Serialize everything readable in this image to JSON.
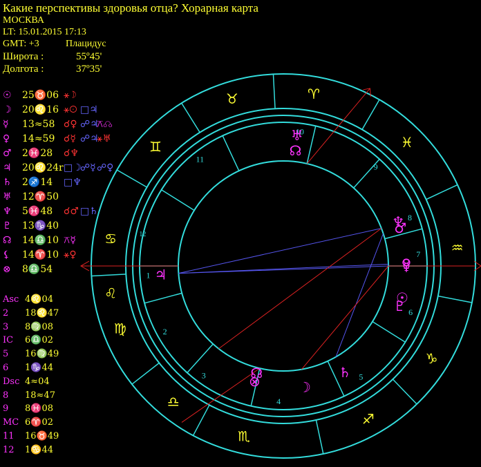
{
  "header": {
    "title": "Какие перспективы здоровья отца? Хорарная карта",
    "city": "МОСКВА",
    "lt": "LT: 15.01.2015  17:13",
    "gmt": "GMT: +3",
    "system": "Плацидус",
    "lat_label": "Широта :",
    "lat_value": "55º45'",
    "lon_label": "Долгота :",
    "lon_value": "37º35'"
  },
  "planets": [
    {
      "glyph": "☉",
      "color": "#ff33ff",
      "value": "25♉06",
      "aspects": [
        {
          "t": "⚹☽",
          "c": "#ff3333"
        }
      ]
    },
    {
      "glyph": "☽",
      "color": "#ff33ff",
      "value": "20♌16",
      "aspects": [
        {
          "t": "⚹☉",
          "c": "#ff3333"
        },
        {
          "t": "□♃",
          "c": "#6666ff"
        }
      ]
    },
    {
      "glyph": "☿",
      "color": "#ff33ff",
      "value": "13≈58",
      "aspects": [
        {
          "t": "☌♀",
          "c": "#ff3333"
        },
        {
          "t": "☍♃",
          "c": "#6666ff"
        },
        {
          "t": "⚻☊",
          "c": "#ff33ff"
        }
      ]
    },
    {
      "glyph": "♀",
      "color": "#ff33ff",
      "value": "14≈59",
      "aspects": [
        {
          "t": "☌☿",
          "c": "#ff3333"
        },
        {
          "t": "☍♃",
          "c": "#6666ff"
        },
        {
          "t": "⚹♅",
          "c": "#ff3333"
        }
      ]
    },
    {
      "glyph": "♂",
      "color": "#ff33ff",
      "value": "2♓28",
      "aspects": [
        {
          "t": "☌♆",
          "c": "#ff3333"
        }
      ]
    },
    {
      "glyph": "♃",
      "color": "#ff33ff",
      "value": "20♌24r",
      "aspects": [
        {
          "t": "□☽",
          "c": "#6666ff"
        },
        {
          "t": "☍☿",
          "c": "#6666ff"
        },
        {
          "t": "☍♀",
          "c": "#6666ff"
        }
      ]
    },
    {
      "glyph": "♄",
      "color": "#ff33ff",
      "value": "2♐14",
      "aspects": [
        {
          "t": "□♆",
          "c": "#6666ff"
        }
      ]
    },
    {
      "glyph": "♅",
      "color": "#ff33ff",
      "value": "12♈50",
      "aspects": []
    },
    {
      "glyph": "♆",
      "color": "#ff33ff",
      "value": "5♓48",
      "aspects": [
        {
          "t": "☌♂",
          "c": "#ff3333"
        },
        {
          "t": "□♄",
          "c": "#6666ff"
        }
      ]
    },
    {
      "glyph": "♇",
      "color": "#ff33ff",
      "value": "13♑40",
      "aspects": []
    },
    {
      "glyph": "☊",
      "color": "#ff33ff",
      "value": "14♎10",
      "aspects": [
        {
          "t": "⚻☿",
          "c": "#ff33ff"
        }
      ]
    },
    {
      "glyph": "⚸",
      "color": "#ff33ff",
      "value": "14♈10",
      "aspects": [
        {
          "t": "⚹♀",
          "c": "#ff3333"
        }
      ]
    },
    {
      "glyph": "⊗",
      "color": "#ff33ff",
      "value": "8♎54",
      "aspects": []
    }
  ],
  "houses": [
    {
      "label": "Asc",
      "color": "#ff33ff",
      "value": "4♌04"
    },
    {
      "label": "2",
      "color": "#ff33ff",
      "value": "18♌47"
    },
    {
      "label": "3",
      "color": "#ff33ff",
      "value": "8♍08"
    },
    {
      "label": "IC",
      "color": "#ff33ff",
      "value": "6♎02"
    },
    {
      "label": "5",
      "color": "#ff33ff",
      "value": "16♍49"
    },
    {
      "label": "6",
      "color": "#ff33ff",
      "value": "1♑44"
    },
    {
      "label": "Dsc",
      "color": "#ff33ff",
      "value": "4≈04"
    },
    {
      "label": "8",
      "color": "#ff33ff",
      "value": "18≈47"
    },
    {
      "label": "9",
      "color": "#ff33ff",
      "value": "8♓08"
    },
    {
      "label": "MC",
      "color": "#ff33ff",
      "value": "6♈02"
    },
    {
      "label": "11",
      "color": "#ff33ff",
      "value": "16♉49"
    },
    {
      "label": "12",
      "color": "#ff33ff",
      "value": "1♋44"
    }
  ],
  "wheel": {
    "signs": [
      {
        "glyph": "♉",
        "angle": 107,
        "color": "#ffff33"
      },
      {
        "glyph": "♈",
        "angle": 80,
        "color": "#ffff33"
      },
      {
        "glyph": "♓",
        "angle": 45,
        "color": "#ffff33"
      },
      {
        "glyph": "♒",
        "angle": 6,
        "color": "#ffff33"
      },
      {
        "glyph": "♑",
        "angle": -32,
        "color": "#ffff33"
      },
      {
        "glyph": "♐",
        "angle": -61,
        "color": "#ffff33"
      },
      {
        "glyph": "♏",
        "angle": -103,
        "color": "#ffff33"
      },
      {
        "glyph": "♎",
        "angle": -129,
        "color": "#ffff33"
      },
      {
        "glyph": "♍",
        "angle": -159,
        "color": "#ffff33"
      },
      {
        "glyph": "♌",
        "angle": -171,
        "color": "#ffff33"
      },
      {
        "glyph": "♋",
        "angle": 171,
        "color": "#ffff33"
      },
      {
        "glyph": "♊",
        "angle": 137,
        "color": "#ffff33"
      }
    ],
    "house_numbers": [
      {
        "label": "1",
        "angle": -176
      },
      {
        "label": "2",
        "angle": -151
      },
      {
        "label": "3",
        "angle": -126
      },
      {
        "label": "4",
        "angle": -92
      },
      {
        "label": "5",
        "angle": -55
      },
      {
        "label": "6",
        "angle": -20
      },
      {
        "label": "7",
        "angle": 5
      },
      {
        "label": "8",
        "angle": 21
      },
      {
        "label": "9",
        "angle": 47
      },
      {
        "label": "10",
        "angle": 83
      },
      {
        "label": "11",
        "angle": 128
      },
      {
        "label": "12",
        "angle": 167
      }
    ],
    "planets": [
      {
        "glyph": "♅",
        "angle": 84,
        "color": "#ff33ff"
      },
      {
        "glyph": "☊",
        "angle": 84,
        "color": "#ff33ff"
      },
      {
        "glyph": "♆",
        "angle": 21,
        "color": "#ff33ff"
      },
      {
        "glyph": "♂",
        "angle": 18,
        "color": "#ff33ff"
      },
      {
        "glyph": "♀",
        "angle": 1,
        "color": "#ff33ff"
      },
      {
        "glyph": "☿",
        "angle": 0,
        "color": "#ff33ff"
      },
      {
        "glyph": "☉",
        "angle": -15,
        "color": "#ff33ff"
      },
      {
        "glyph": "♇",
        "angle": -19,
        "color": "#ff33ff"
      },
      {
        "glyph": "♄",
        "angle": -60,
        "color": "#ff33ff"
      },
      {
        "glyph": "☽",
        "angle": -80,
        "color": "#ff33ff"
      },
      {
        "glyph": "⊗",
        "angle": -104,
        "color": "#ff33ff"
      },
      {
        "glyph": "☊",
        "angle": -104,
        "color": "#ff33ff"
      },
      {
        "glyph": "♃",
        "angle": -176,
        "color": "#ff33ff"
      }
    ]
  }
}
